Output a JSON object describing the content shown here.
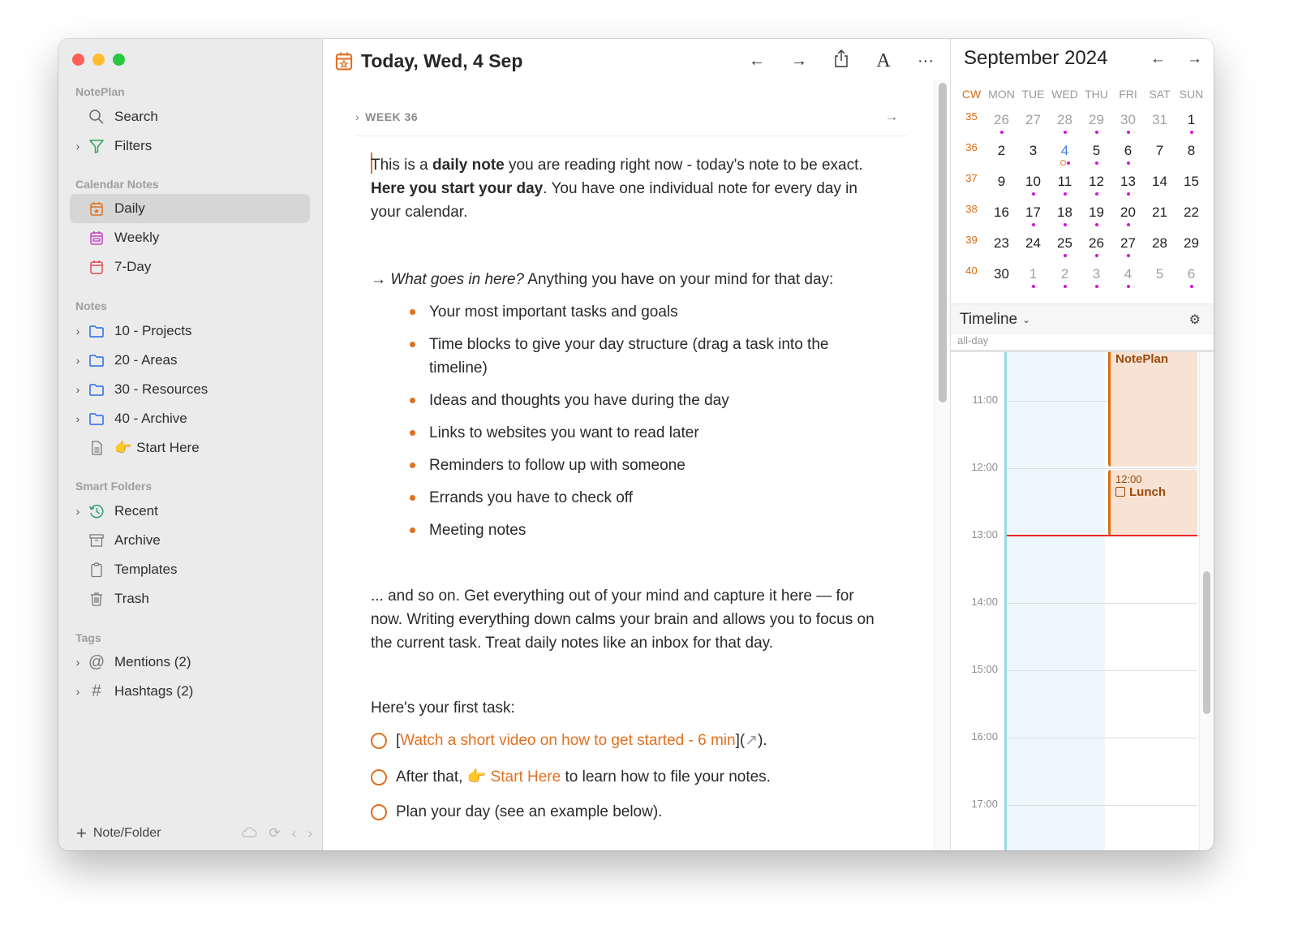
{
  "sidebar": {
    "app_section": "NotePlan",
    "search": "Search",
    "filters": "Filters",
    "calendar_section": "Calendar Notes",
    "calendar_items": [
      "Daily",
      "Weekly",
      "7-Day"
    ],
    "notes_section": "Notes",
    "folders": [
      "10 - Projects",
      "20 - Areas",
      "30 - Resources",
      "40 - Archive"
    ],
    "start_here": {
      "emoji": "👉",
      "label": "Start Here"
    },
    "smart_section": "Smart Folders",
    "smart_items": [
      "Recent",
      "Archive",
      "Templates",
      "Trash"
    ],
    "tags_section": "Tags",
    "tag_items": [
      "Mentions (2)",
      "Hashtags (2)"
    ],
    "footer": {
      "plus": "+",
      "new_label": "Note/Folder"
    }
  },
  "editor": {
    "title": "Today, Wed, 4 Sep",
    "actions": {
      "back": "←",
      "forward": "→",
      "share": "⇪",
      "font": "A",
      "more": "···"
    },
    "week_label": "WEEK 36",
    "week_chevron": "›",
    "week_arrow": "→",
    "p1": {
      "a": "This is a ",
      "b": "daily note",
      "c": " you are reading right now - today's note to be exact. ",
      "d": "Here you start your day",
      "e": ". You have one individual note for every day in your calendar."
    },
    "p2": {
      "arrow": "→ ",
      "italic": "What goes in here?",
      "rest": " Anything you have on your mind for that day:"
    },
    "bullets": [
      "Your most important tasks and goals",
      "Time blocks to give your day structure (drag a task into the timeline)",
      "Ideas and thoughts you have during the day",
      "Links to websites you want to read later",
      "Reminders to follow up with someone",
      "Errands you have to check off",
      "Meeting notes"
    ],
    "p3": "... and so on. Get everything out of your mind and capture it here — for now. Writing everything down calms your brain and allows you to focus on the current task. Treat daily notes like an inbox for that day.",
    "first_task_label": "Here's your first task:",
    "tasks": {
      "t1": {
        "open": "[",
        "link": "Watch a short video on how to get started - 6 min",
        "mid": "](",
        "icon": "↗",
        "close": ")."
      },
      "t2": {
        "pre": "After that, ",
        "emoji": "👉",
        "link": " Start Here",
        "post": " to learn how to file your notes."
      },
      "t3": "Plan your day (see an example below)."
    }
  },
  "calendar": {
    "month_title": "September 2024",
    "prev": "←",
    "next": "→",
    "cw_label": "CW",
    "weekdays": [
      "MON",
      "TUE",
      "WED",
      "THU",
      "FRI",
      "SAT",
      "SUN"
    ],
    "weeks": [
      {
        "cw": "35",
        "days": [
          {
            "d": "26",
            "other": true,
            "dot": true
          },
          {
            "d": "27",
            "other": true
          },
          {
            "d": "28",
            "other": true,
            "dot": true
          },
          {
            "d": "29",
            "other": true,
            "dot": true
          },
          {
            "d": "30",
            "other": true,
            "dot": true
          },
          {
            "d": "31",
            "other": true
          },
          {
            "d": "1",
            "dot": true
          }
        ]
      },
      {
        "cw": "36",
        "days": [
          {
            "d": "2"
          },
          {
            "d": "3"
          },
          {
            "d": "4",
            "today": true,
            "dot": true,
            "ring": true
          },
          {
            "d": "5",
            "dot": true
          },
          {
            "d": "6",
            "dot": true
          },
          {
            "d": "7"
          },
          {
            "d": "8"
          }
        ]
      },
      {
        "cw": "37",
        "days": [
          {
            "d": "9"
          },
          {
            "d": "10",
            "dot": true
          },
          {
            "d": "11",
            "dot": true
          },
          {
            "d": "12",
            "dot": true
          },
          {
            "d": "13",
            "dot": true
          },
          {
            "d": "14"
          },
          {
            "d": "15"
          }
        ]
      },
      {
        "cw": "38",
        "days": [
          {
            "d": "16"
          },
          {
            "d": "17",
            "dot": true
          },
          {
            "d": "18",
            "dot": true
          },
          {
            "d": "19",
            "dot": true
          },
          {
            "d": "20",
            "dot": true
          },
          {
            "d": "21"
          },
          {
            "d": "22"
          }
        ]
      },
      {
        "cw": "39",
        "days": [
          {
            "d": "23"
          },
          {
            "d": "24"
          },
          {
            "d": "25",
            "dot": true
          },
          {
            "d": "26",
            "dot": true
          },
          {
            "d": "27",
            "dot": true
          },
          {
            "d": "28"
          },
          {
            "d": "29"
          }
        ]
      },
      {
        "cw": "40",
        "days": [
          {
            "d": "30"
          },
          {
            "d": "1",
            "other": true,
            "dot": true
          },
          {
            "d": "2",
            "other": true,
            "dot": true
          },
          {
            "d": "3",
            "other": true,
            "dot": true
          },
          {
            "d": "4",
            "other": true,
            "dot": true
          },
          {
            "d": "5",
            "other": true
          },
          {
            "d": "6",
            "other": true,
            "dot": true
          }
        ]
      }
    ],
    "colors": {
      "cw": "#d66a12",
      "dot": "#d516d5",
      "today_bg": "#cfe3fb",
      "today_text": "#3d7ee0"
    }
  },
  "timeline": {
    "title": "Timeline",
    "chevron": "⌄",
    "gear": "⚙",
    "all_day": "all-day",
    "hours": [
      "11:00",
      "12:00",
      "13:00",
      "14:00",
      "15:00",
      "16:00",
      "17:00"
    ],
    "events": [
      {
        "title": "NotePlan",
        "time": "",
        "checkbox": false
      },
      {
        "title": "Lunch",
        "time": "12:00",
        "checkbox": true
      }
    ],
    "now": "13:00",
    "colors": {
      "event_bg": "#f7e2d4",
      "event_accent": "#d86d10",
      "now_line": "#ee2a24"
    }
  },
  "accent": "#e07020"
}
